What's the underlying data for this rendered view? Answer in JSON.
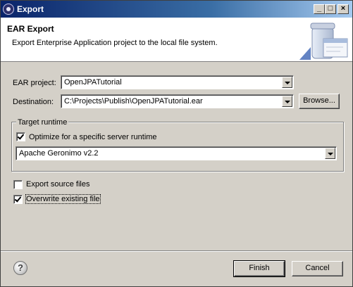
{
  "window": {
    "title": "Export",
    "controls": {
      "minimize": "_",
      "maximize": "□",
      "close": "×"
    }
  },
  "header": {
    "title": "EAR Export",
    "description": "Export Enterprise Application project to the local file system.",
    "icon": "export-wizard-icon"
  },
  "form": {
    "ear_project_label": "EAR project:",
    "ear_project_value": "OpenJPATutorial",
    "destination_label": "Destination:",
    "destination_value": "C:\\Projects\\Publish\\OpenJPATutorial.ear",
    "browse_label": "Browse..."
  },
  "target_runtime": {
    "group_label": "Target runtime",
    "optimize_label": "Optimize for a specific server runtime",
    "optimize_checked": true,
    "runtime_value": "Apache Geronimo v2.2"
  },
  "options": {
    "export_source_label": "Export source files",
    "export_source_checked": false,
    "overwrite_label": "Overwrite existing file",
    "overwrite_checked": true
  },
  "footer": {
    "help_icon": "question-icon",
    "help_glyph": "?",
    "finish_label": "Finish",
    "cancel_label": "Cancel"
  },
  "colors": {
    "title_bar_start": "#0a246a",
    "title_bar_end": "#a6caf0",
    "dialog_face": "#d4d0c8"
  }
}
